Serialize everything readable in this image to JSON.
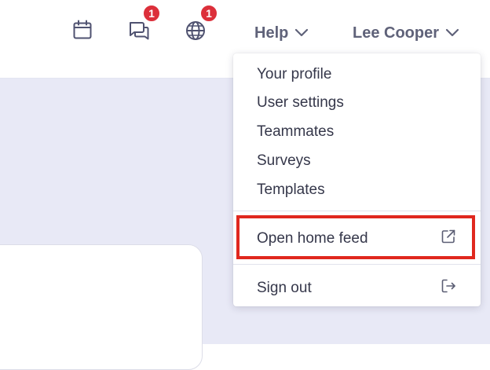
{
  "header": {
    "calendar_icon": "calendar-icon",
    "messages": {
      "icon": "chat-icon",
      "badge": "1"
    },
    "globe": {
      "icon": "globe-icon",
      "badge": "1"
    },
    "help_label": "Help",
    "user_name": "Lee Cooper"
  },
  "user_menu": {
    "items": [
      {
        "label": "Your profile"
      },
      {
        "label": "User settings"
      },
      {
        "label": "Teammates"
      },
      {
        "label": "Surveys"
      },
      {
        "label": "Templates"
      }
    ],
    "open_home_feed": {
      "label": "Open home feed",
      "icon": "external-link-icon"
    },
    "sign_out": {
      "label": "Sign out",
      "icon": "sign-out-icon"
    }
  },
  "colors": {
    "badge": "#dc2f3a",
    "highlight_border": "#e0281e",
    "content_background": "#e8e9f6"
  }
}
